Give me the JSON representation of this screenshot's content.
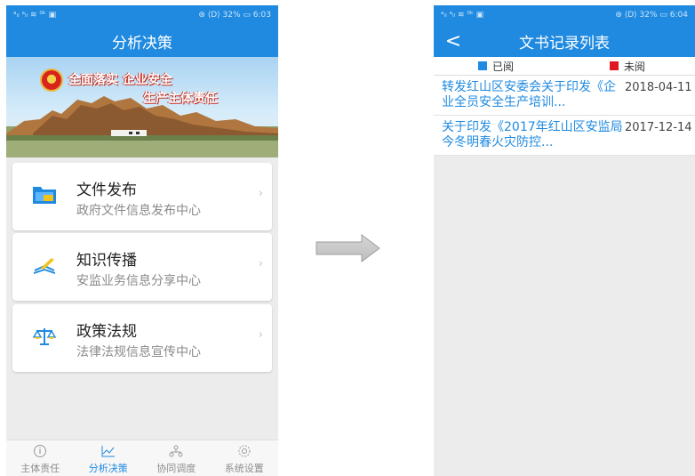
{
  "left": {
    "status_left": "ᵃᵢₗ ᵃᵢₗ ≋ ⁰ᵏ ▣",
    "status_right": "⊛ ⟨D⟩ 32% ▭ 6:03",
    "title": "分析决策",
    "banner": {
      "line1": "全面落实 企业安全",
      "line2": "生产主体责任"
    },
    "menu": [
      {
        "title": "文件发布",
        "subtitle": "政府文件信息发布中心",
        "icon": "folder-icon"
      },
      {
        "title": "知识传播",
        "subtitle": "安监业务信息分享中心",
        "icon": "book-pen-icon"
      },
      {
        "title": "政策法规",
        "subtitle": "法律法规信息宣传中心",
        "icon": "scales-icon"
      }
    ],
    "chevron": "›",
    "tabs": [
      {
        "label": "主体责任",
        "icon": "info-icon",
        "active": false
      },
      {
        "label": "分析决策",
        "icon": "chart-icon",
        "active": true
      },
      {
        "label": "协同调度",
        "icon": "flow-icon",
        "active": false
      },
      {
        "label": "系统设置",
        "icon": "gear-icon",
        "active": false
      }
    ]
  },
  "right": {
    "status_left": "ᵃᵢₗ ᵃᵢₗ ≋ ⁰ᵏ ▣",
    "status_right": "⊛ ⟨D⟩ 32% ▭ 6:04",
    "title": "文书记录列表",
    "back": "<",
    "legend": {
      "read": "已阅",
      "unread": "未阅",
      "read_color": "#1f8ae0",
      "unread_color": "#e0181f"
    },
    "documents": [
      {
        "title": "转发红山区安委会关于印发《企业全员安全生产培训...",
        "date": "2018-04-11"
      },
      {
        "title": "关于印发《2017年红山区安监局今冬明春火灾防控...",
        "date": "2017-12-14"
      }
    ]
  },
  "colors": {
    "primary": "#1f8ae0",
    "background": "#ececec"
  }
}
